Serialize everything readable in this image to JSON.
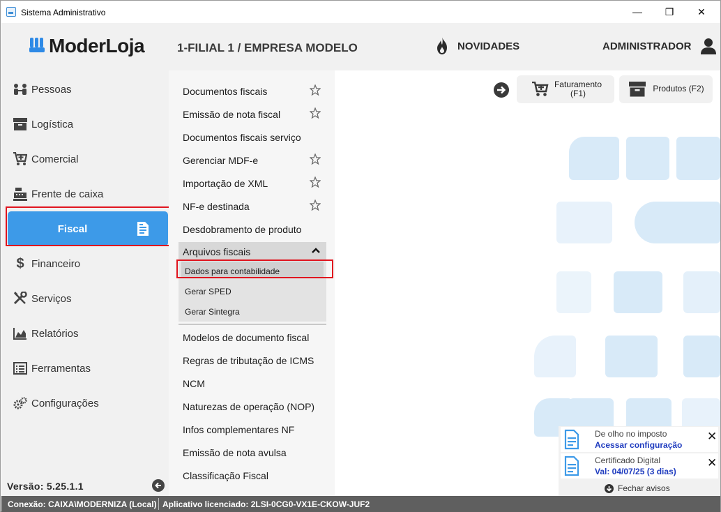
{
  "window": {
    "title": "Sistema Administrativo",
    "minimize": "—",
    "maximize": "❐",
    "close": "✕"
  },
  "header": {
    "logo_text": "ModerLoja",
    "company": "1-FILIAL 1 / EMPRESA MODELO",
    "news_label": "NOVIDADES",
    "user_label": "ADMINISTRADOR"
  },
  "sidebar": {
    "items": [
      {
        "label": "Pessoas",
        "icon": "people-icon"
      },
      {
        "label": "Logística",
        "icon": "box-icon"
      },
      {
        "label": "Comercial",
        "icon": "cart-icon"
      },
      {
        "label": "Frente de caixa",
        "icon": "cash-register-icon"
      },
      {
        "label": "Fiscal",
        "icon": "document-icon",
        "active": true
      },
      {
        "label": "Financeiro",
        "icon": "dollar-icon"
      },
      {
        "label": "Serviços",
        "icon": "tools-icon"
      },
      {
        "label": "Relatórios",
        "icon": "chart-icon"
      },
      {
        "label": "Ferramentas",
        "icon": "list-icon"
      },
      {
        "label": "Configurações",
        "icon": "gears-icon"
      }
    ],
    "version": "Versão:  5.25.1.1"
  },
  "submenu": {
    "items_top": [
      {
        "label": "Documentos fiscais",
        "star": true
      },
      {
        "label": "Emissão de nota fiscal",
        "star": true
      },
      {
        "label": "Documentos fiscais serviço",
        "star": false
      },
      {
        "label": "Gerenciar MDF-e",
        "star": true
      },
      {
        "label": "Importação de XML",
        "star": true
      },
      {
        "label": "NF-e destinada",
        "star": true
      },
      {
        "label": "Desdobramento de produto",
        "star": false
      }
    ],
    "group": {
      "label": "Arquivos fiscais",
      "items": [
        "Dados para contabilidade",
        "Gerar SPED",
        "Gerar Sintegra"
      ]
    },
    "items_bottom": [
      "Modelos de documento fiscal",
      "Regras de tributação de ICMS",
      "NCM",
      "Naturezas de operação (NOP)",
      "Infos complementares NF",
      "Emissão de nota avulsa",
      "Classificação Fiscal"
    ]
  },
  "main": {
    "quick": {
      "faturamento_line1": "Faturamento",
      "faturamento_line2": "(F1)",
      "produtos": "Produtos (F2)"
    }
  },
  "notices": {
    "cards": [
      {
        "title": "De olho no imposto",
        "link": "Acessar configuração"
      },
      {
        "title": "Certificado Digital",
        "link": "Val: 04/07/25 (3 dias)"
      }
    ],
    "close_all": "Fechar avisos"
  },
  "status": {
    "connection": "Conexão: CAIXA\\MODERNIZA (Local)",
    "license": "Aplicativo licenciado: 2LSI-0CG0-VX1E-CKOW-JUF2"
  },
  "colors": {
    "accent": "#3d9ae8",
    "highlight": "#e0141e",
    "tile": "#d8eaf8",
    "link": "#1f3cbf"
  }
}
